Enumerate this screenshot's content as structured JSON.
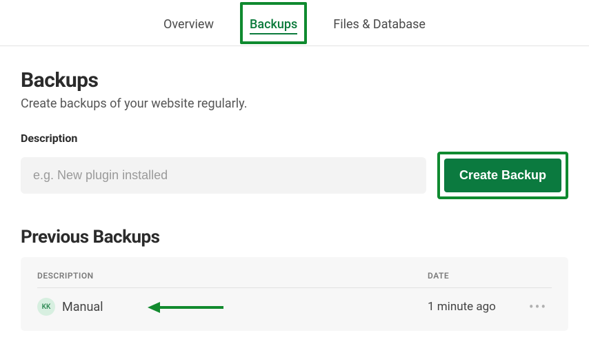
{
  "tabs": {
    "overview": "Overview",
    "backups": "Backups",
    "files_db": "Files & Database"
  },
  "page": {
    "title": "Backups",
    "subtitle": "Create backups of your website regularly."
  },
  "form": {
    "label": "Description",
    "placeholder": "e.g. New plugin installed",
    "value": "",
    "button": "Create Backup"
  },
  "previous": {
    "title": "Previous Backups",
    "columns": {
      "description": "DESCRIPTION",
      "date": "DATE"
    },
    "rows": [
      {
        "avatar": "KK",
        "description": "Manual",
        "date": "1 minute ago"
      }
    ]
  }
}
